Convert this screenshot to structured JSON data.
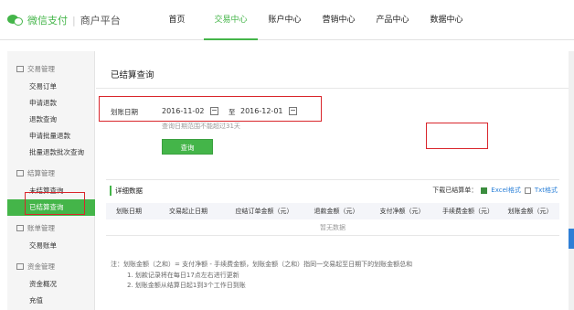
{
  "header": {
    "brand": "微信支付",
    "separator": "|",
    "subtitle": "商户平台",
    "nav": [
      "首页",
      "交易中心",
      "账户中心",
      "营销中心",
      "产品中心",
      "数据中心"
    ],
    "active_nav": "交易中心"
  },
  "sidebar": {
    "groups": [
      {
        "title": "交易管理",
        "items": [
          "交易订单",
          "申请退款",
          "退款查询",
          "申请批量退款",
          "批量退款批次查询"
        ]
      },
      {
        "title": "结算管理",
        "items": [
          "未结算查询",
          "已结算查询"
        ]
      },
      {
        "title": "账单管理",
        "items": [
          "交易账单"
        ]
      },
      {
        "title": "资金管理",
        "items": [
          "资金概况",
          "充值"
        ]
      }
    ],
    "active_item": "已结算查询"
  },
  "main": {
    "title": "已结算查询",
    "date_label": "划账日期",
    "start_date": "2016-11-02",
    "to_text": "至",
    "end_date": "2016-12-01",
    "range_hint": "查询日期范围不能超过31天",
    "query_button": "查询",
    "detail_title": "详细数据",
    "download_label": "下载已结算单：",
    "excel_label": "Excel格式",
    "txt_label": "Txt格式",
    "columns": [
      "划账日期",
      "交易起止日期",
      "应结订单金额（元）",
      "退款金额（元）",
      "支付净额（元）",
      "手续费金额（元）",
      "划账金额（元）"
    ],
    "empty_text": "暂无数据",
    "notes": [
      "注：划账金额（之和）= 支付净额 - 手续费金额，划账金额（之和）指同一交易起至日期下的划账金额总和",
      "1. 划款记录将在每日17点左右进行更新",
      "2. 划账金额从结算日起1到3个工作日到账"
    ]
  },
  "colors": {
    "accent": "#44b549",
    "highlight": "#d9262c",
    "link": "#2b80d8"
  }
}
